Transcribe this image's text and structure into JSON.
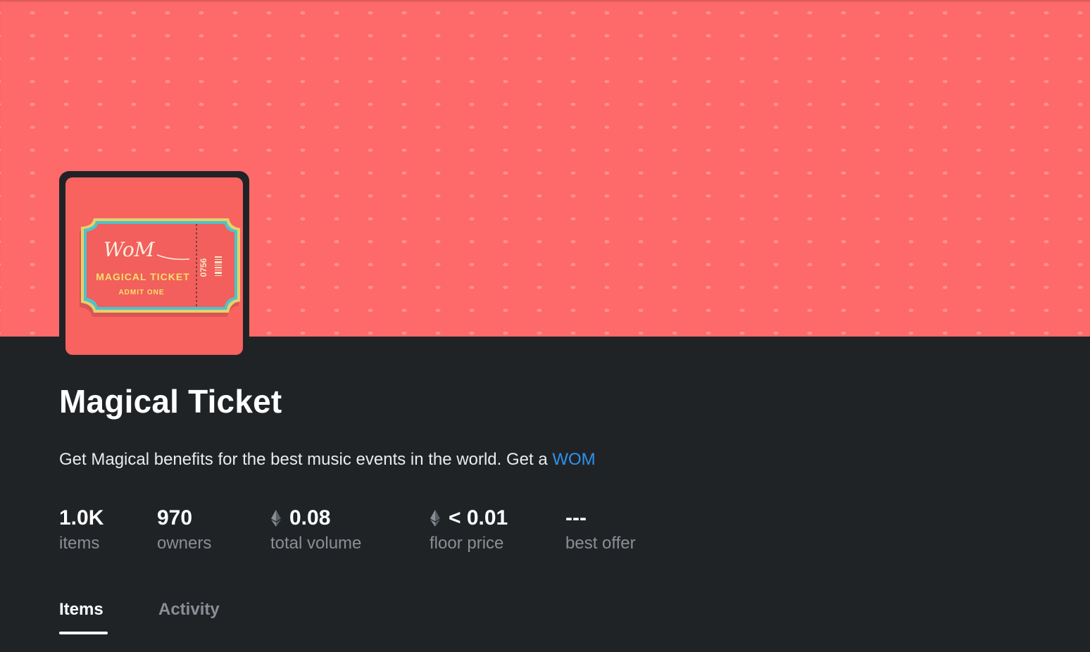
{
  "collection": {
    "title": "Magical Ticket",
    "description_text": "Get Magical benefits for the best music events in the world. Get a ",
    "description_link": "WOM",
    "avatar": {
      "brand_text": "WoM",
      "ticket_title": "MAGICAL TICKET",
      "ticket_subtitle": "ADMIT ONE",
      "ticket_number": "0756"
    }
  },
  "stats": [
    {
      "value": "1.0K",
      "label": "items",
      "icon": ""
    },
    {
      "value": "970",
      "label": "owners",
      "icon": ""
    },
    {
      "value": "0.08",
      "label": "total volume",
      "icon": "ethereum-icon"
    },
    {
      "value": "< 0.01",
      "label": "floor price",
      "icon": "ethereum-icon"
    },
    {
      "value": "---",
      "label": "best offer",
      "icon": ""
    }
  ],
  "tabs": [
    {
      "label": "Items",
      "active": true
    },
    {
      "label": "Activity",
      "active": false
    }
  ],
  "colors": {
    "banner": "#fd6a69",
    "background": "#202326",
    "link": "#2f92ee",
    "muted_text": "#8a8f95"
  }
}
